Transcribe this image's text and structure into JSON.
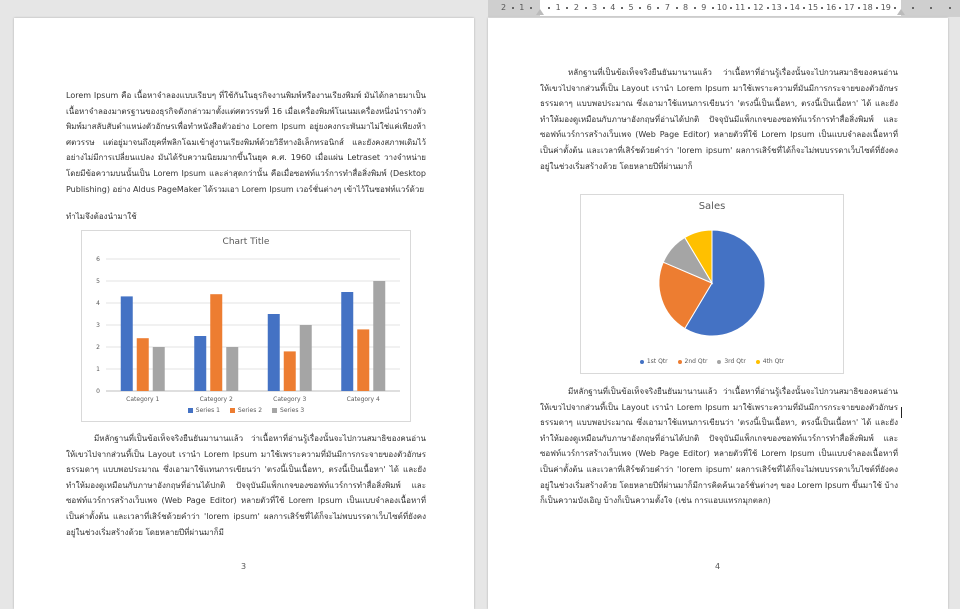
{
  "ruler": {
    "labels": [
      "2",
      "1",
      "1",
      "2",
      "3",
      "4",
      "5",
      "6",
      "7",
      "8",
      "9",
      "10",
      "11",
      "12",
      "13",
      "14",
      "15",
      "16",
      "17",
      "18",
      "19"
    ]
  },
  "left_page": {
    "para1": "Lorem Ipsum คือ เนื้อหาจำลองแบบเรียบๆ ที่ใช้กันในธุรกิจงานพิมพ์หรืองานเรียงพิมพ์ มันได้กลายมาเป็นเนื้อหาจำลองมาตรฐานของธุรกิจดังกล่าวมาตั้งแต่ศตวรรษที่ 16 เมื่อเครื่องพิมพ์โนเนมเครื่องหนึ่งนำรางตัวพิมพ์มาสลับสับตำแหน่งตัวอักษรเพื่อทำหนังสือตัวอย่าง Lorem Ipsum อยู่ยงคงกระพันมาไม่ใช่แค่เพียงห้าศตวรรษ แต่อยู่มาจนถึงยุคที่พลิกโฉมเข้าสู่งานเรียงพิมพ์ด้วยวิธีทางอิเล็กทรอนิกส์ และยังคงสภาพเดิมไว้อย่างไม่มีการเปลี่ยนแปลง มันได้รับความนิยมมากขึ้นในยุค ค.ศ. 1960 เมื่อแผ่น Letraset วางจำหน่ายโดยมีข้อความบนนั้นเป็น Lorem Ipsum และล่าสุดกว่านั้น คือเมื่อซอฟท์แวร์การทำสื่อสิ่งพิมพ์ (Desktop Publishing) อย่าง Aldus PageMaker ได้รวมเอา Lorem Ipsum เวอร์ชั่นต่างๆ เข้าไว้ในซอฟท์แวร์ด้วย",
    "heading": "ทำไมจึงต้องนำมาใช้",
    "para2": "มีหลักฐานที่เป็นข้อเท็จจริงยืนยันมานานแล้ว ว่าเนื้อหาที่อ่านรู้เรื่องนั้นจะไปกวนสมาธิของคนอ่านให้เขวไปจากส่วนที้เป็น Layout เรานำ Lorem Ipsum มาใช้เพราะความที่มันมีการกระจายของตัวอักษรธรรมดาๆ แบบพอประมาณ ซึ่งเอามาใช้แทนการเขียนว่า 'ตรงนี้เป็นเนื้อหา, ตรงนี้เป็นเนื้อหา' ได้ และยังทำให้มองดูเหมือนกับภาษาอังกฤษที่อ่านได้ปกติ ปัจจุบันมีแพ็กเกจของซอฟท์แวร์การทำสื่อสิ่งพิมพ์ และซอฟท์แวร์การสร้างเว็บเพจ (Web Page Editor) หลายตัวที่ใช้ Lorem Ipsum เป็นแบบจำลองเนื้อหาที่เป็นค่าตั้งต้น และเวลาที่เสิร์ชด้วยคำว่า 'lorem ipsum' ผลการเสิร์ชที่ได้ก็จะไม่พบบรรดาเว็บไซต์ที่ยังคงอยู่ในช่วงเริ่มสร้างด้วย โดยหลายปีที่ผ่านมาก็มี",
    "page_number": "3"
  },
  "right_page": {
    "para1": "หลักฐานที่เป็นข้อเท็จจริงยืนยันมานานแล้ว ว่าเนื้อหาที่อ่านรู้เรื่องนั้นจะไปกวนสมาธิของคนอ่านให้เขวไปจากส่วนที้เป็น Layout เรานำ Lorem Ipsum มาใช้เพราะความที่มันมีการกระจายของตัวอักษรธรรมดาๆ แบบพอประมาณ ซึ่งเอามาใช้แทนการเขียนว่า 'ตรงนี้เป็นเนื้อหา, ตรงนี้เป็นเนื้อหา' ได้ และยังทำให้มองดูเหมือนกับภาษาอังกฤษที่อ่านได้ปกติ ปัจจุบันมีแพ็กเกจของซอฟท์แวร์การทำสื่อสิ่งพิมพ์ และซอฟท์แวร์การสร้างเว็บเพจ (Web Page Editor) หลายตัวที่ใช้ Lorem Ipsum เป็นแบบจำลองเนื้อหาที่เป็นค่าตั้งต้น และเวลาที่เสิร์ชด้วยคำว่า 'lorem ipsum' ผลการเสิร์ชที่ได้ก็จะไม่พบบรรดาเว็บไซต์ที่ยังคงอยู่ในช่วงเริ่มสร้างด้วย โดยหลายปีที่ผ่านมาก็",
    "para2": "มีหลักฐานที่เป็นข้อเท็จจริงยืนยันมานานแล้ว ว่าเนื้อหาที่อ่านรู้เรื่องนั้นจะไปกวนสมาธิของคนอ่านให้เขวไปจากส่วนที้เป็น Layout เรานำ Lorem Ipsum มาใช้เพราะความที่มันมีการกระจายของตัวอักษรธรรมดาๆ แบบพอประมาณ ซึ่งเอามาใช้แทนการเขียนว่า 'ตรงนี้เป็นเนื้อหา, ตรงนี้เป็นเนื้อหา' ได้ และยังทำให้มองดูเหมือนกับภาษาอังกฤษที่อ่านได้ปกติ ปัจจุบันมีแพ็กเกจของซอฟท์แวร์การทำสื่อสิ่งพิมพ์ และซอฟท์แวร์การสร้างเว็บเพจ (Web Page Editor) หลายตัวที่ใช้ Lorem Ipsum เป็นแบบจำลองเนื้อหาที่เป็นค่าตั้งต้น และเวลาที่เสิร์ชด้วยคำว่า 'lorem ipsum' ผลการเสิร์ชที่ได้ก็จะไม่พบบรรดาเว็บไซต์ที่ยังคงอยู่ในช่วงเริ่มสร้างด้วย โดยหลายปีที่ผ่านมาก็มีการคิดค้นเวอร์ชั่นต่างๆ ของ Lorem Ipsum ขึ้นมาใช้ บ้างก็เป็นความบังเอิญ บ้างก็เป็นความตั้งใจ (เช่น การแอบแทรกมุกตลก)",
    "page_number": "4"
  },
  "colors": {
    "series1": "#4472c4",
    "series2": "#ed7d31",
    "series3": "#a5a5a5",
    "series4": "#ffc000"
  },
  "chart_data": [
    {
      "type": "bar",
      "title": "Chart Title",
      "categories": [
        "Category 1",
        "Category 2",
        "Category 3",
        "Category 4"
      ],
      "series": [
        {
          "name": "Series 1",
          "values": [
            4.3,
            2.5,
            3.5,
            4.5
          ]
        },
        {
          "name": "Series 2",
          "values": [
            2.4,
            4.4,
            1.8,
            2.8
          ]
        },
        {
          "name": "Series 3",
          "values": [
            2,
            2,
            3,
            5
          ]
        }
      ],
      "ylim": [
        0,
        6
      ],
      "yticks": [
        "0",
        "1",
        "2",
        "3",
        "4",
        "5",
        "6"
      ],
      "grid": true,
      "legend": "bottom"
    },
    {
      "type": "pie",
      "title": "Sales",
      "categories": [
        "1st Qtr",
        "2nd Qtr",
        "3rd Qtr",
        "4th Qtr"
      ],
      "values": [
        8.2,
        3.2,
        1.4,
        1.2
      ],
      "legend": "bottom"
    }
  ]
}
